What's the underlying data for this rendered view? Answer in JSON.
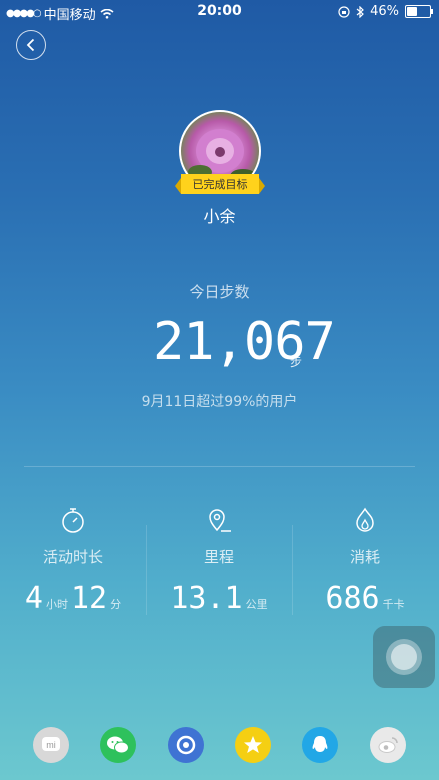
{
  "status": {
    "carrier": "中国移动",
    "time": "20:00",
    "battery": "46%"
  },
  "profile": {
    "goal_badge": "已完成目标",
    "name": "小余"
  },
  "steps": {
    "title": "今日步数",
    "count": "21,067",
    "unit": "步",
    "subtitle": "9月11日超过99%的用户"
  },
  "stats": {
    "active": {
      "label": "活动时长",
      "hours": "4",
      "hours_unit": "小时",
      "minutes": "12",
      "minutes_unit": "分"
    },
    "distance": {
      "label": "里程",
      "value": "13.1",
      "unit": "公里"
    },
    "calories": {
      "label": "消耗",
      "value": "686",
      "unit": "千卡"
    }
  },
  "share": [
    {
      "icon": "mi-icon",
      "color": "#d8d8d8"
    },
    {
      "icon": "wechat-icon",
      "color": "#2ec15c"
    },
    {
      "icon": "moments-icon",
      "color": "#3f73d3"
    },
    {
      "icon": "qzone-icon",
      "color": "#f5cf13"
    },
    {
      "icon": "qq-icon",
      "color": "#22a7e6"
    },
    {
      "icon": "weibo-icon",
      "color": "#e9e9e9"
    }
  ]
}
